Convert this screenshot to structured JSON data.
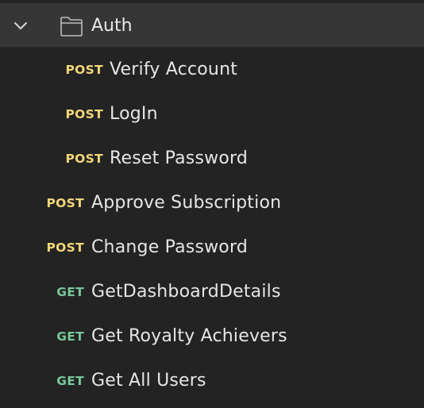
{
  "folder": {
    "name": "Auth",
    "expanded": true,
    "chevron_icon": "chevron-down-icon",
    "folder_icon": "folder-icon"
  },
  "colors": {
    "post": "#f2d778",
    "get": "#79c79a",
    "background": "#232323",
    "folder_row_background": "#363636"
  },
  "requests": [
    {
      "method": "POST",
      "name": "Verify Account"
    },
    {
      "method": "POST",
      "name": "LogIn"
    },
    {
      "method": "POST",
      "name": "Reset Password"
    },
    {
      "method": "POST",
      "name": "Approve Subscription"
    },
    {
      "method": "POST",
      "name": "Change Password"
    },
    {
      "method": "GET",
      "name": "GetDashboardDetails"
    },
    {
      "method": "GET",
      "name": "Get Royalty Achievers"
    },
    {
      "method": "GET",
      "name": "Get All Users"
    }
  ]
}
